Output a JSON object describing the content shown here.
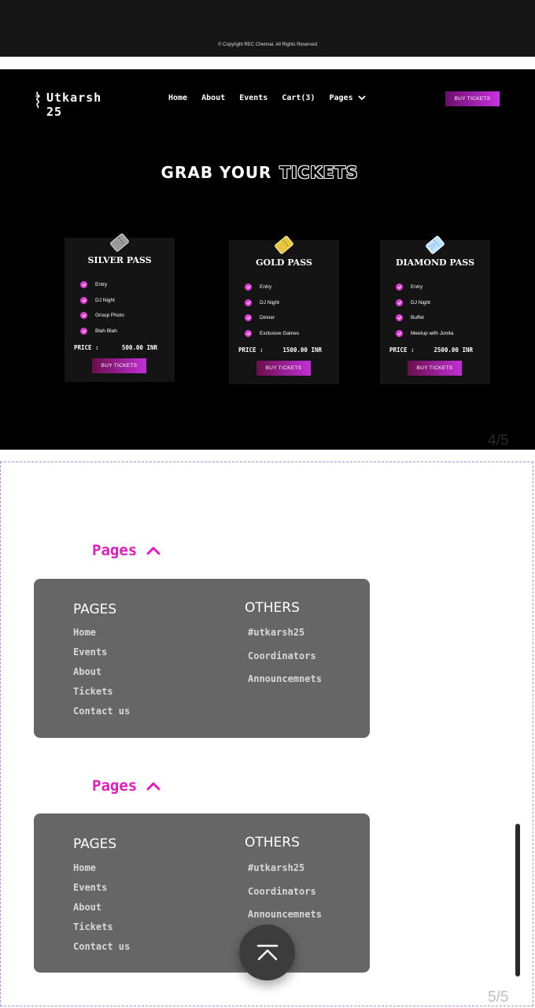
{
  "copyright": "© Copyright REC Chennai. All Rights Reserved",
  "header": {
    "logo_line1": "Utkarsh",
    "logo_line2": "25",
    "nav": [
      "Home",
      "About",
      "Events",
      "Cart(3)",
      "Pages"
    ],
    "buy_label": "BUY TICKETS"
  },
  "heading": {
    "part1": "GRAB YOUR",
    "part2": "TICKETS"
  },
  "cards": [
    {
      "title": "SILVER PASS",
      "features": [
        "Entry",
        "DJ Night",
        "Group Photo",
        "Blah Blah"
      ],
      "price_label": "PRICE :",
      "price": "500.00 INR",
      "button": "BUY TICKETS",
      "icon": "silver-ticket-icon",
      "accent": "#9a9a9a"
    },
    {
      "title": "GOLD PASS",
      "features": [
        "Entry",
        "DJ Night",
        "Dinner",
        "Exclusive Games"
      ],
      "price_label": "PRICE :",
      "price": "1500.00 INR",
      "button": "BUY TICKETS",
      "icon": "gold-ticket-icon",
      "accent": "#e8c640"
    },
    {
      "title": "DIAMOND PASS",
      "features": [
        "Entry",
        "DJ Night",
        "Buffet",
        "Meetup with Jonita"
      ],
      "price_label": "PRICE :",
      "price": "2500.00 INR",
      "button": "BUY TICKETS",
      "icon": "diamond-ticket-icon",
      "accent": "#bfe3ff"
    }
  ],
  "page_indicators": {
    "upper": "4/5",
    "lower": "5/5"
  },
  "menus": [
    {
      "toggle": "Pages",
      "pages_heading": "PAGES",
      "pages": [
        "Home",
        "Events",
        "About",
        "Tickets",
        "Contact us"
      ],
      "others_heading": "OTHERS",
      "others": [
        "#utkarsh25",
        "Coordinators",
        "Announcemnets"
      ]
    },
    {
      "toggle": "Pages",
      "pages_heading": "PAGES",
      "pages": [
        "Home",
        "Events",
        "About",
        "Tickets",
        "Contact us"
      ],
      "others_heading": "OTHERS",
      "others": [
        "#utkarsh25",
        "Coordinators",
        "Announcemnets"
      ]
    }
  ],
  "colors": {
    "accent_pink": "#e11bbd",
    "button_gradient_start": "#6a0e6a",
    "button_gradient_end": "#c832e0",
    "menu_bg": "#666666"
  }
}
